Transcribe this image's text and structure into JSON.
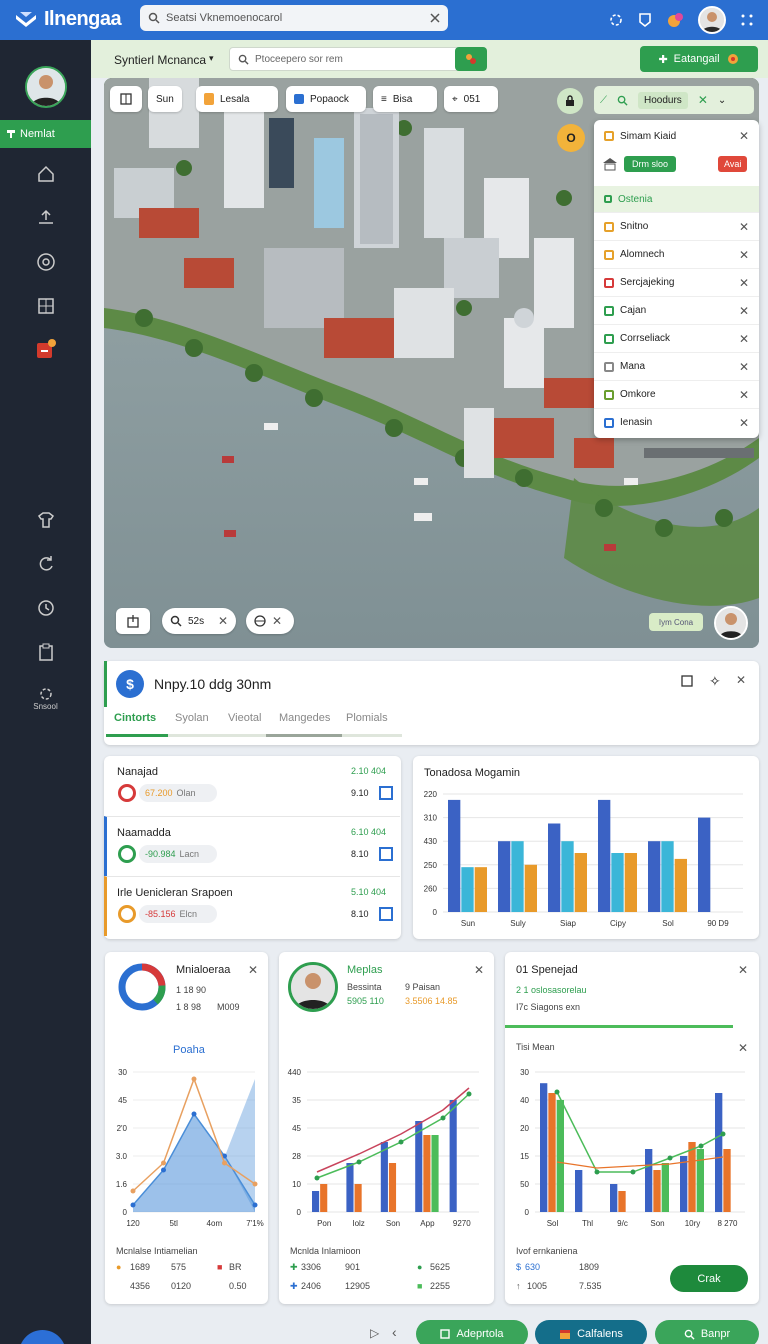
{
  "app": {
    "title": "Ilnengaa",
    "search_placeholder": "Seatsi Vknemoenocarol"
  },
  "sidebar": {
    "active_label": "Nemlat",
    "bottom_label": "Snsool"
  },
  "subheader": {
    "title": "Syntierl Mcnanca",
    "search_placeholder": "Ptoceepero sor rem",
    "action_label": "Eatangail"
  },
  "map": {
    "chips": [
      "Sun",
      "Lesala",
      "Popaock",
      "Bisa",
      "051"
    ],
    "marker_label": "O",
    "filter_label": "Hoodurs",
    "zoom_value": "52s",
    "corner_label": "Iym Cona",
    "layers": {
      "title": "Simam Kiaid",
      "btn_green": "Drm sloo",
      "btn_red": "Avai",
      "section": "Ostenia",
      "items": [
        {
          "name": "Snitno",
          "color": "#e6a12a"
        },
        {
          "name": "Alomnech",
          "color": "#e6a12a"
        },
        {
          "name": "Sercjajeking",
          "color": "#d63a3a"
        },
        {
          "name": "Cajan",
          "color": "#2e9e4f"
        },
        {
          "name": "Corrseliack",
          "color": "#2e9e4f"
        },
        {
          "name": "Mana",
          "color": "#888888"
        },
        {
          "name": "Omkore",
          "color": "#6a9e2e"
        },
        {
          "name": "Ienasin",
          "color": "#2b6fd1"
        }
      ]
    }
  },
  "detail": {
    "title": "Nnpy.10 ddg 30nm",
    "tabs": [
      "Cintorts",
      "Syolan",
      "Vieotal",
      "Mangedes",
      "Plomials"
    ]
  },
  "stats": [
    {
      "label": "Nanajad",
      "value": "2.10",
      "pill": "67.200",
      "pill_sub": "Olan",
      "right1": "2.10 404",
      "right2": "9.10"
    },
    {
      "label": "Naamadda",
      "value": "6.10",
      "pill": "-90.984",
      "pill_sub": "Lacn",
      "right1": "6.10 404",
      "right2": "8.10"
    },
    {
      "label": "Irle Uenicleran Srapoen",
      "value": "5.10",
      "pill": "-85.156",
      "pill_sub": "Elcn",
      "right1": "5.10 404",
      "right2": "8.10"
    }
  ],
  "chart_data": [
    {
      "type": "bar",
      "title": "Tonadosa Mogamin",
      "categories": [
        "Sun",
        "Suly",
        "Siap",
        "Cipy",
        "Sol",
        "90 D9"
      ],
      "y_ticks": [
        "220",
        "310",
        "430",
        "250",
        "260",
        "0"
      ],
      "series": [
        {
          "values": [
            0.95,
            0.6,
            0.75,
            0.95,
            0.6,
            0.8
          ],
          "color": "#3b62c4"
        },
        {
          "values": [
            0.38,
            0.6,
            0.6,
            0.5,
            0.6,
            0.0
          ],
          "color": "#3bb6d8"
        },
        {
          "values": [
            0.38,
            0.4,
            0.5,
            0.5,
            0.45,
            0.0
          ],
          "color": "#e89a2a"
        }
      ]
    },
    {
      "type": "area",
      "title": "Mnialoeraa",
      "subtitle": "Poaha",
      "stat1": "1 18 90",
      "stat2": "1 8 98",
      "stat3": "M009",
      "x_ticks": [
        "120",
        "5tl",
        "4om",
        "7'1%"
      ],
      "y_ticks": [
        "30",
        "45",
        "2'0",
        "3.0",
        "1.6",
        "0"
      ],
      "series": [
        {
          "values": [
            0.05,
            0.3,
            0.7,
            0.4,
            0.05
          ],
          "color": "#4a8ed8"
        },
        {
          "values": [
            0.15,
            0.35,
            0.95,
            0.35,
            0.2
          ],
          "color": "#e8a060"
        }
      ],
      "footer": {
        "label": "Mcnlalse Intiamelian",
        "a1": "1689",
        "a2": "575",
        "a3": "BR",
        "b1": "4356",
        "b2": "0120",
        "b3": "0.50"
      }
    },
    {
      "type": "bar",
      "title": "Meplas",
      "stat1": "Bessinta",
      "stat2": "9 Paisan",
      "stat3": "5905 110",
      "stat4": "3.5506 14.85",
      "x_ticks": [
        "Pon",
        "Iolz",
        "Son",
        "App",
        "9270"
      ],
      "y_ticks": [
        "440",
        "35",
        "45",
        "28",
        "10",
        "0"
      ],
      "series": [
        {
          "values": [
            0.15,
            0.35,
            0.5,
            0.65,
            0.8
          ],
          "color": "#3b62c4"
        },
        {
          "values": [
            0.2,
            0.2,
            0.35,
            0.55,
            0.0
          ],
          "color": "#e8742a"
        },
        {
          "values": [
            0.0,
            0.0,
            0.0,
            0.55,
            0.0
          ],
          "color": "#4cbc5a"
        }
      ],
      "footer": {
        "label": "Mcnlda Inlamioon",
        "a1": "3306",
        "a2": "901",
        "a3": "5625",
        "b1": "2406",
        "b2": "12905",
        "b3": "2255"
      }
    },
    {
      "type": "bar",
      "title": "01 Spenejad",
      "stat1": "2 1 oslosasorelau",
      "stat2": "I7c Siagons exn",
      "subtitle": "Tisi Mean",
      "x_ticks": [
        "Sol",
        "Thl",
        "9/c",
        "Son",
        "10ry",
        "8 270"
      ],
      "y_ticks": [
        "30",
        "40",
        "20",
        "15",
        "50",
        "0"
      ],
      "series": [
        {
          "values": [
            0.92,
            0.3,
            0.2,
            0.45,
            0.4,
            0.85
          ],
          "color": "#3b62c4"
        },
        {
          "values": [
            0.85,
            0.0,
            0.15,
            0.3,
            0.5,
            0.45
          ],
          "color": "#e8742a"
        },
        {
          "values": [
            0.8,
            0.0,
            0.0,
            0.35,
            0.45,
            0.0
          ],
          "color": "#4cbc5a"
        }
      ],
      "footer": {
        "label": "Ivof ernkaniena",
        "a1": "630",
        "a2": "1809",
        "b1": "1005",
        "b2": "7.535",
        "button": "Crak"
      }
    }
  ],
  "bottom": {
    "btn1": "Adeprtola",
    "btn2": "Calfalens",
    "btn3": "Banpr"
  }
}
